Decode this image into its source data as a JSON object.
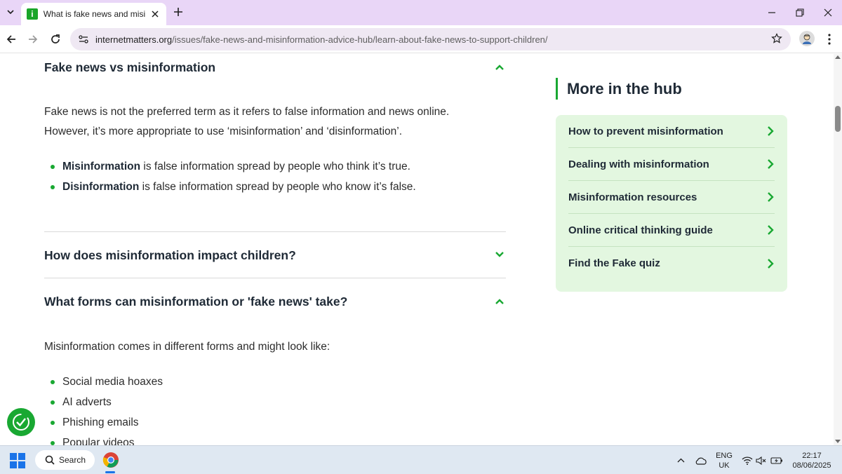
{
  "browser": {
    "tab_title": "What is fake news and misinformation",
    "url_host": "internetmatters.org",
    "url_path": "/issues/fake-news-and-misinformation-advice-hub/learn-about-fake-news-to-support-children/"
  },
  "article": {
    "section1": {
      "title": "Fake news vs misinformation",
      "para_line1": "Fake news is not the preferred term as it refers to false information and news online.",
      "para_line2": "However, it’s more appropriate to use ‘misinformation’ and ‘disinformation’.",
      "bullets": [
        {
          "term": "Misinformation",
          "text": " is false information spread by people who think it’s true."
        },
        {
          "term": "Disinformation",
          "text": " is false information spread by people who know it’s false."
        }
      ]
    },
    "section2": {
      "title": "How does misinformation impact children?"
    },
    "section3": {
      "title": "What forms can misinformation or 'fake news' take?",
      "intro": "Misinformation comes in different forms and might look like:",
      "bullets": [
        "Social media hoaxes",
        "AI adverts",
        "Phishing emails",
        "Popular videos"
      ]
    }
  },
  "hub": {
    "heading": "More in the hub",
    "items": [
      "How to prevent misinformation",
      "Dealing with misinformation",
      "Misinformation resources",
      "Online critical thinking guide",
      "Find the Fake quiz"
    ]
  },
  "taskbar": {
    "search_label": "Search",
    "lang_line1": "ENG",
    "lang_line2": "UK",
    "time": "22:17",
    "date": "08/06/2025"
  },
  "colors": {
    "accent_green": "#19a832",
    "hub_bg": "#e3f7e0",
    "tabstrip": "#e9d6f7"
  }
}
